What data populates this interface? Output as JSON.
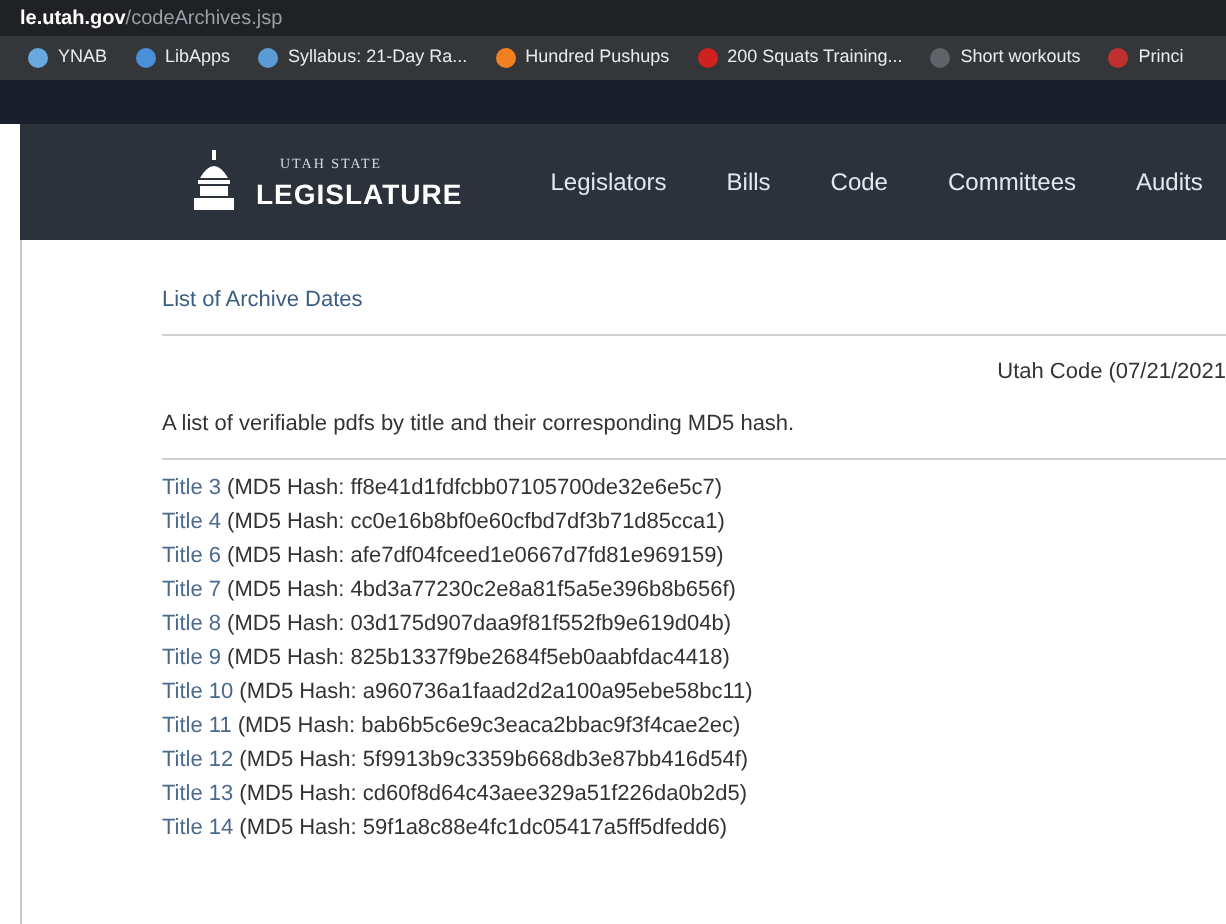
{
  "address_bar": {
    "domain": "le.utah.gov",
    "path": "/codeArchives.jsp"
  },
  "bookmarks": [
    {
      "label": "YNAB",
      "color": "#6aa9e0"
    },
    {
      "label": "LibApps",
      "color": "#4a90d9"
    },
    {
      "label": "Syllabus: 21-Day Ra...",
      "color": "#5b9bd5"
    },
    {
      "label": "Hundred Pushups",
      "color": "#f08020"
    },
    {
      "label": "200 Squats Training...",
      "color": "#d02020"
    },
    {
      "label": "Short workouts",
      "color": "#5f6368"
    },
    {
      "label": "Princi",
      "color": "#c03030"
    }
  ],
  "site_header": {
    "logo_small": "UTAH STATE",
    "logo_large": "LEGISLATURE",
    "nav": [
      "Legislators",
      "Bills",
      "Code",
      "Committees",
      "Audits"
    ]
  },
  "breadcrumb": "List of Archive Dates",
  "archive_heading": "Utah Code (07/21/2021",
  "description": "A list of verifiable pdfs by title and their corresponding MD5 hash.",
  "titles": [
    {
      "title": "Title 3",
      "hash": "(MD5 Hash: ff8e41d1fdfcbb07105700de32e6e5c7)"
    },
    {
      "title": "Title 4",
      "hash": "(MD5 Hash: cc0e16b8bf0e60cfbd7df3b71d85cca1)"
    },
    {
      "title": "Title 6",
      "hash": "(MD5 Hash: afe7df04fceed1e0667d7fd81e969159)"
    },
    {
      "title": "Title 7",
      "hash": "(MD5 Hash: 4bd3a77230c2e8a81f5a5e396b8b656f)"
    },
    {
      "title": "Title 8",
      "hash": "(MD5 Hash: 03d175d907daa9f81f552fb9e619d04b)"
    },
    {
      "title": "Title 9",
      "hash": "(MD5 Hash: 825b1337f9be2684f5eb0aabfdac4418)"
    },
    {
      "title": "Title 10",
      "hash": "(MD5 Hash: a960736a1faad2d2a100a95ebe58bc11)"
    },
    {
      "title": "Title 11",
      "hash": "(MD5 Hash: bab6b5c6e9c3eaca2bbac9f3f4cae2ec)"
    },
    {
      "title": "Title 12",
      "hash": "(MD5 Hash: 5f9913b9c3359b668db3e87bb416d54f)"
    },
    {
      "title": "Title 13",
      "hash": "(MD5 Hash: cd60f8d64c43aee329a51f226da0b2d5)"
    },
    {
      "title": "Title 14",
      "hash": "(MD5 Hash: 59f1a8c88e4fc1dc05417a5ff5dfedd6)"
    }
  ]
}
